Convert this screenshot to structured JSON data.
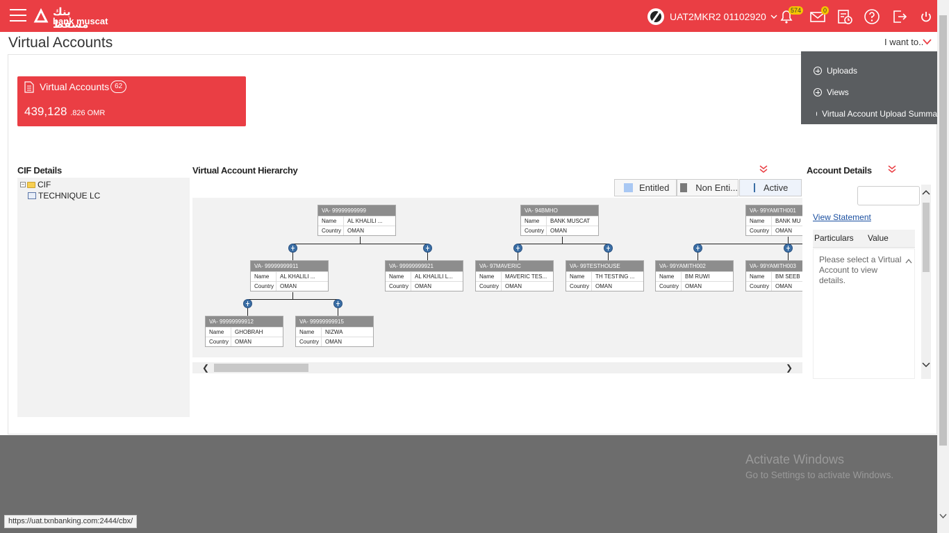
{
  "header": {
    "logo_ar": "بنك مسقط",
    "logo_en": "bank muscat",
    "user": "UAT2MKR2 01102920",
    "notification_count": "574",
    "mail_count": "0",
    "accent_color": "#ea3e44"
  },
  "page": {
    "title": "Virtual Accounts",
    "i_want_to": "I want to.."
  },
  "menu": {
    "uploads": "Uploads",
    "views": "Views",
    "summary": "Virtual Account Upload Summa"
  },
  "tile": {
    "title": "Virtual Accounts",
    "count": "62",
    "amount_main": "439,128",
    "amount_sub": ".826 OMR"
  },
  "cif": {
    "title": "CIF Details",
    "root": "CIF",
    "child": "TECHNIQUE LC"
  },
  "hierarchy": {
    "title": "Virtual Account Hierarchy",
    "legend": {
      "entitled": "Entitled",
      "non_entitled": "Non Enti...",
      "active": "Active"
    },
    "labels": {
      "name": "Name",
      "country": "Country"
    },
    "nodes": [
      {
        "id": "VA- 99999999999",
        "name": "AL KHALILI ...",
        "country": "OMAN"
      },
      {
        "id": "VA- 94BMHO",
        "name": "BANK MUSCAT",
        "country": "OMAN"
      },
      {
        "id": "VA- 99YAMITH001",
        "name": "BANK MU",
        "country": "OMAN"
      },
      {
        "id": "VA- 99999999911",
        "name": "AL KHALILI ...",
        "country": "OMAN"
      },
      {
        "id": "VA- 99999999921",
        "name": "AL KHALILI L...",
        "country": "OMAN"
      },
      {
        "id": "VA- 97MAVERIC",
        "name": "MAVERIC TES...",
        "country": "OMAN"
      },
      {
        "id": "VA- 99TESTHOUSE",
        "name": "TH TESTING ...",
        "country": "OMAN"
      },
      {
        "id": "VA- 99YAMITH002",
        "name": "BM RUWI",
        "country": "OMAN"
      },
      {
        "id": "VA- 99YAMITH003",
        "name": "BM SEEB",
        "country": "OMAN"
      },
      {
        "id": "VA- 99999999912",
        "name": "GHOBRAH",
        "country": "OMAN"
      },
      {
        "id": "VA- 99999999915",
        "name": "NIZWA",
        "country": "OMAN"
      }
    ]
  },
  "account_details": {
    "title": "Account Details",
    "view_statement": "View Statement",
    "col_particulars": "Particulars",
    "col_value": "Value",
    "empty_msg": "Please select a Virtual Account to view details."
  },
  "windows": {
    "activate_title": "Activate Windows",
    "activate_sub": "Go to Settings to activate Windows."
  },
  "status_url": "https://uat.txnbanking.com:2444/cbx/"
}
